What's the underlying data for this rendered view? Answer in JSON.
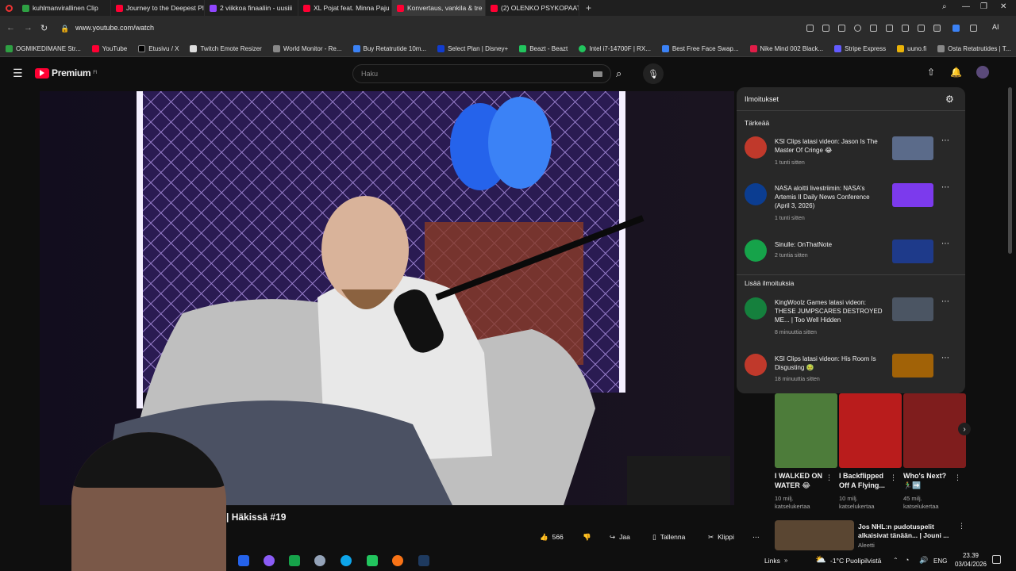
{
  "browser": {
    "tabs": [
      {
        "title": "kuhlmanvirallinen Clip",
        "color": "#2ea043"
      },
      {
        "title": "Journey to the Deepest Pl",
        "color": "#ff0033"
      },
      {
        "title": "2 viikkoa finaaliin - uusiii",
        "color": "#9146ff"
      },
      {
        "title": "XL Pojat feat. Minna Paju",
        "color": "#ff0033"
      },
      {
        "title": "Konvertaus, vankila & tre",
        "color": "#ff0033"
      },
      {
        "title": "(2) OLENKO PSYKOPAATTI",
        "color": "#ff0033"
      }
    ],
    "new_tab": "+",
    "url": "www.youtube.com/watch",
    "profile_label": "AI"
  },
  "bookmarks": [
    {
      "label": "OGMIKEDIMANE Str...",
      "color": "#2ea043"
    },
    {
      "label": "YouTube",
      "color": "#ff0033"
    },
    {
      "label": "Etusivu / X",
      "color": "#000000"
    },
    {
      "label": "Twitch Emote Resizer",
      "color": "#dddddd"
    },
    {
      "label": "World Monitor - Re...",
      "color": "#888888"
    },
    {
      "label": "Buy Retatrutide 10m...",
      "color": "#3b82f6"
    },
    {
      "label": "Select Plan | Disney+",
      "color": "#113ccf"
    },
    {
      "label": "Beazt - Beazt",
      "color": "#22c55e"
    },
    {
      "label": "Intel i7-14700F | RX...",
      "color": "#22c55e"
    },
    {
      "label": "Best Free Face Swap...",
      "color": "#3b82f6"
    },
    {
      "label": "Nike Mind 002 Black...",
      "color": "#e11d48"
    },
    {
      "label": "Stripe Express",
      "color": "#635bff"
    },
    {
      "label": "uuno.fi",
      "color": "#eab308"
    },
    {
      "label": "Osta Retatrutides | T...",
      "color": "#888888"
    }
  ],
  "youtube": {
    "brand": "Premium",
    "brand_sup": "FI",
    "search_placeholder": "Haku"
  },
  "notifications": {
    "title": "Ilmoitukset",
    "important_header": "Tärkeää",
    "more_header": "Lisää ilmoituksia",
    "items": [
      {
        "text": "KSI Clips latasi videon: Jason Is The Master Of Cringe 😂",
        "time": "1 tunti sitten",
        "avatar_color": "#c0392b",
        "thumb_color": "#5b6b8a"
      },
      {
        "text": "NASA aloitti livestriimin: NASA's Artemis II Daily News Conference (April 3, 2026)",
        "time": "1 tunti sitten",
        "avatar_color": "#0b3d91",
        "thumb_color": "#7c3aed"
      },
      {
        "text": "Sinulle: OnThatNote",
        "time": "2 tuntia sitten",
        "avatar_color": "#16a34a",
        "thumb_color": "#1e3a8a"
      },
      {
        "text": "KingWoolz Games latasi videon: THESE JUMPSCARES DESTROYED ME... | Too Well Hidden",
        "time": "8 minuuttia sitten",
        "avatar_color": "#15803d",
        "thumb_color": "#4b5563"
      },
      {
        "text": "KSI Clips latasi videon: His Room Is Disgusting 🤢",
        "time": "18 minuuttia sitten",
        "avatar_color": "#c0392b",
        "thumb_color": "#a16207"
      }
    ]
  },
  "shorts": [
    {
      "title": "I WALKED ON WATER 😂",
      "views": "10 milj. katselukertaa",
      "color": "#4d7c3a"
    },
    {
      "title": "I Backflipped Off A Flying...",
      "views": "10 milj. katselukertaa",
      "color": "#b91c1c"
    },
    {
      "title": "Who's Next? 🏃‍♂️➡️",
      "views": "45 milj. katselukertaa",
      "color": "#7f1d1d"
    }
  ],
  "video": {
    "title_fragment": "| Häkissä #19"
  },
  "actions": {
    "likes": "566",
    "share": "Jaa",
    "save": "Tallenna",
    "clip": "Klippi",
    "more": "⋯"
  },
  "recommended": {
    "title": "Jos NHL:n pudotuspelit alkaisivat tänään... | Jouni ...",
    "channel": "Aleetti"
  },
  "taskbar": {
    "links": "Links",
    "weather": "-1°C  Puolipilvistä",
    "lang": "ENG",
    "time": "23.39",
    "date": "03/04/2026"
  },
  "colors": {
    "youtube_red": "#ff0033",
    "panel_bg": "#282828",
    "page_bg": "#0f0f0f"
  }
}
